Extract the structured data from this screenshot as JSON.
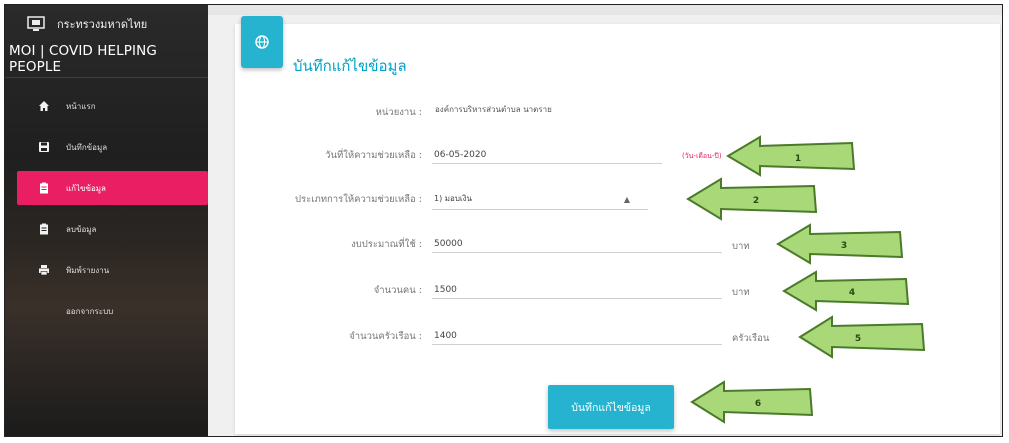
{
  "sidebar": {
    "ministry": "กระทรวงมหาดไทย",
    "system_name": "MOI | COVID HELPING PEOPLE",
    "items": [
      {
        "label": "หน้าแรก",
        "icon": "home-icon"
      },
      {
        "label": "บันทึกข้อมูล",
        "icon": "save-icon"
      },
      {
        "label": "แก้ไขข้อมูล",
        "icon": "clipboard-icon",
        "active": true
      },
      {
        "label": "ลบข้อมูล",
        "icon": "clipboard-icon"
      },
      {
        "label": "พิมพ์รายงาน",
        "icon": "print-icon"
      },
      {
        "label": "ออกจากระบบ",
        "icon": ""
      }
    ]
  },
  "form": {
    "title": "บันทึกแก้ไขข้อมูล",
    "agency_label": "หน่วยงาน :",
    "agency_value": "องค์การบริหารส่วนตำบล นาตราย",
    "date_label": "วันที่ให้ความช่วยเหลือ :",
    "date_value": "06-05-2020",
    "date_hint": "(วัน-เดือน-ปี)",
    "type_label": "ประเภทการให้ความช่วยเหลือ :",
    "type_value": "1) มอบเงิน",
    "budget_label": "งบประมาณที่ใช้ :",
    "budget_value": "50000",
    "budget_unit": "บาท",
    "people_label": "จำนวนคน :",
    "people_value": "1500",
    "people_unit": "บาท",
    "households_label": "จำนวนครัวเรือน :",
    "households_value": "1400",
    "households_unit": "ครัวเรือน",
    "save_label": "บันทึกแก้ไขข้อมูล"
  },
  "callouts": [
    "1",
    "2",
    "3",
    "4",
    "5",
    "6"
  ],
  "colors": {
    "accent": "#26b3cf",
    "active": "#e91e63",
    "arrow_fill": "#a8d878",
    "arrow_stroke": "#4a7a2a"
  }
}
